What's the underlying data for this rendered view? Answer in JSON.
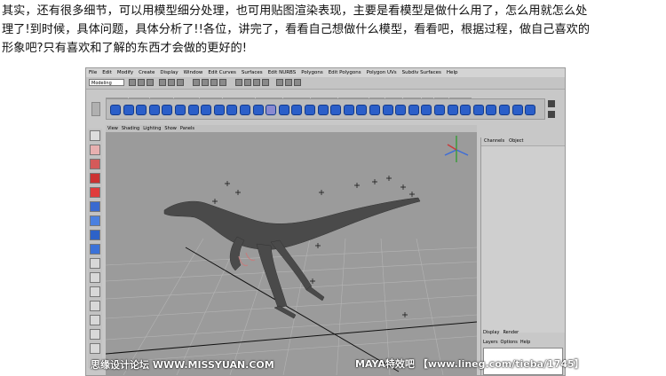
{
  "article": {
    "paragraph": "其实，还有很多细节，可以用模型细分处理，也可用贴图渲染表现，主要是看模型是做什么用了，怎么用就怎么处\n理了!到时候，具体问题，具体分析了!!各位，讲完了，看看自己想做什么模型，看看吧，根据过程，做自己喜欢的\n形象吧?只有喜欢和了解的东西才会做的更好的!"
  },
  "app": {
    "menus": [
      "File",
      "Edit",
      "Modify",
      "Create",
      "Display",
      "Window",
      "Edit Curves",
      "Surfaces",
      "Edit NURBS",
      "Polygons",
      "Edit Polygons",
      "Polygon UVs",
      "Subdiv Surfaces",
      "Help"
    ],
    "mode": "Modeling",
    "shelf_tabs": [
      "General",
      "Curves",
      "Surfaces",
      "Polygons",
      "Subdivs",
      "Deformation",
      "Animation",
      "Dynamics",
      "Rendering",
      "PaintEffects",
      "Toon",
      "Cloth",
      "Fluids",
      "Fur",
      "Hair",
      "Custom"
    ],
    "active_shelf_tab": "Polygons",
    "viewport_menus": [
      "View",
      "Shading",
      "Lighting",
      "Show",
      "Panels"
    ],
    "channel_box": {
      "tabs": [
        "Channels",
        "Object"
      ],
      "radio_options": [
        "Display",
        "Render"
      ],
      "layer_menus": [
        "Layers",
        "Options",
        "Help"
      ]
    }
  },
  "watermarks": {
    "left": "思缘设计论坛 WWW.MISSYUAN.COM",
    "right_brand": "MAYA特效吧",
    "right_url": "【www.lineg.com/tieba/1745】"
  },
  "colors": {
    "shelf_icon": "#2b5fc9",
    "viewport_bg": "#9b9b9b",
    "dinosaur": "#4a4a4a"
  }
}
